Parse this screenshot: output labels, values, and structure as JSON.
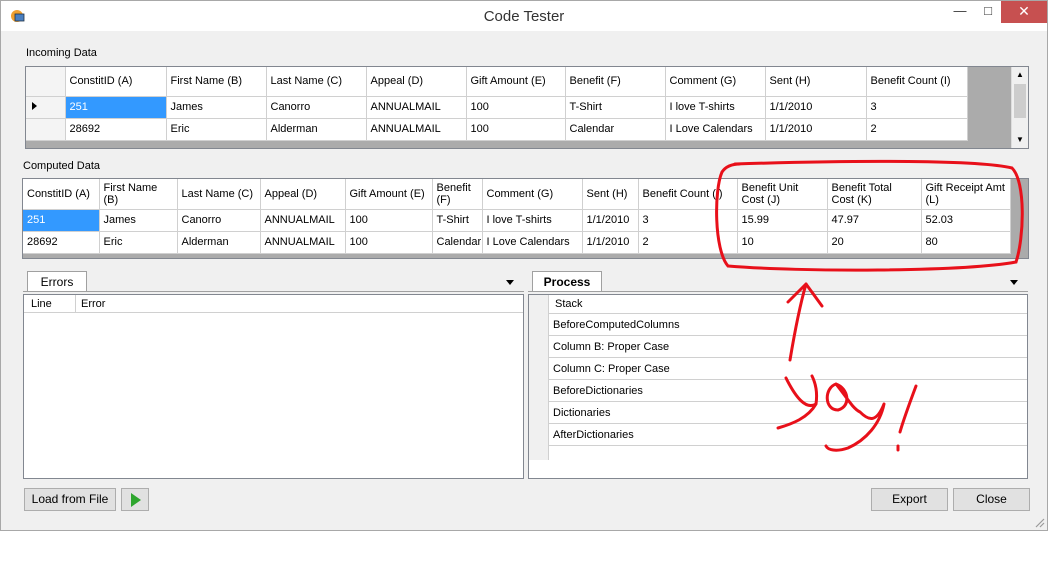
{
  "window": {
    "title": "Code Tester",
    "min": "—",
    "max": "□",
    "close": "✕"
  },
  "incoming": {
    "label": "Incoming Data",
    "headers": [
      "ConstitID (A)",
      "First Name (B)",
      "Last Name (C)",
      "Appeal (D)",
      "Gift Amount (E)",
      "Benefit (F)",
      "Comment (G)",
      "Sent (H)",
      "Benefit Count (I)"
    ],
    "rows": [
      [
        "251",
        "James",
        "Canorro",
        "ANNUALMAIL",
        "100",
        "T-Shirt",
        "I love T-shirts",
        "1/1/2010",
        "3"
      ],
      [
        "28692",
        "Eric",
        "Alderman",
        "ANNUALMAIL",
        "100",
        "Calendar",
        "I Love Calendars",
        "1/1/2010",
        "2"
      ]
    ]
  },
  "computed": {
    "label": "Computed Data",
    "headers": [
      "ConstitID (A)",
      "First Name (B)",
      "Last Name (C)",
      "Appeal (D)",
      "Gift Amount (E)",
      "Benefit (F)",
      "Comment (G)",
      "Sent (H)",
      "Benefit Count (I)",
      "Benefit Unit Cost (J)",
      "Benefit Total Cost (K)",
      "Gift Receipt Amt (L)"
    ],
    "rows": [
      [
        "251",
        "James",
        "Canorro",
        "ANNUALMAIL",
        "100",
        "T-Shirt",
        "I love T-shirts",
        "1/1/2010",
        "3",
        "15.99",
        "47.97",
        "52.03"
      ],
      [
        "28692",
        "Eric",
        "Alderman",
        "ANNUALMAIL",
        "100",
        "Calendar",
        "I Love Calendars",
        "1/1/2010",
        "2",
        "10",
        "20",
        "80"
      ]
    ]
  },
  "errors": {
    "tab": "Errors",
    "headers": [
      "Line",
      "Error"
    ]
  },
  "process": {
    "tab": "Process",
    "header": "Stack",
    "items": [
      "BeforeComputedColumns",
      "Column B: Proper Case",
      "Column C: Proper Case",
      "BeforeDictionaries",
      "Dictionaries",
      "AfterDictionaries"
    ]
  },
  "buttons": {
    "load": "Load from File",
    "export": "Export",
    "close": "Close"
  },
  "annotation": {
    "text": "Yay!",
    "color": "#e8101a"
  },
  "colors": {
    "selection": "#3399ff",
    "close_button": "#c75050",
    "play": "#2ea52e"
  }
}
